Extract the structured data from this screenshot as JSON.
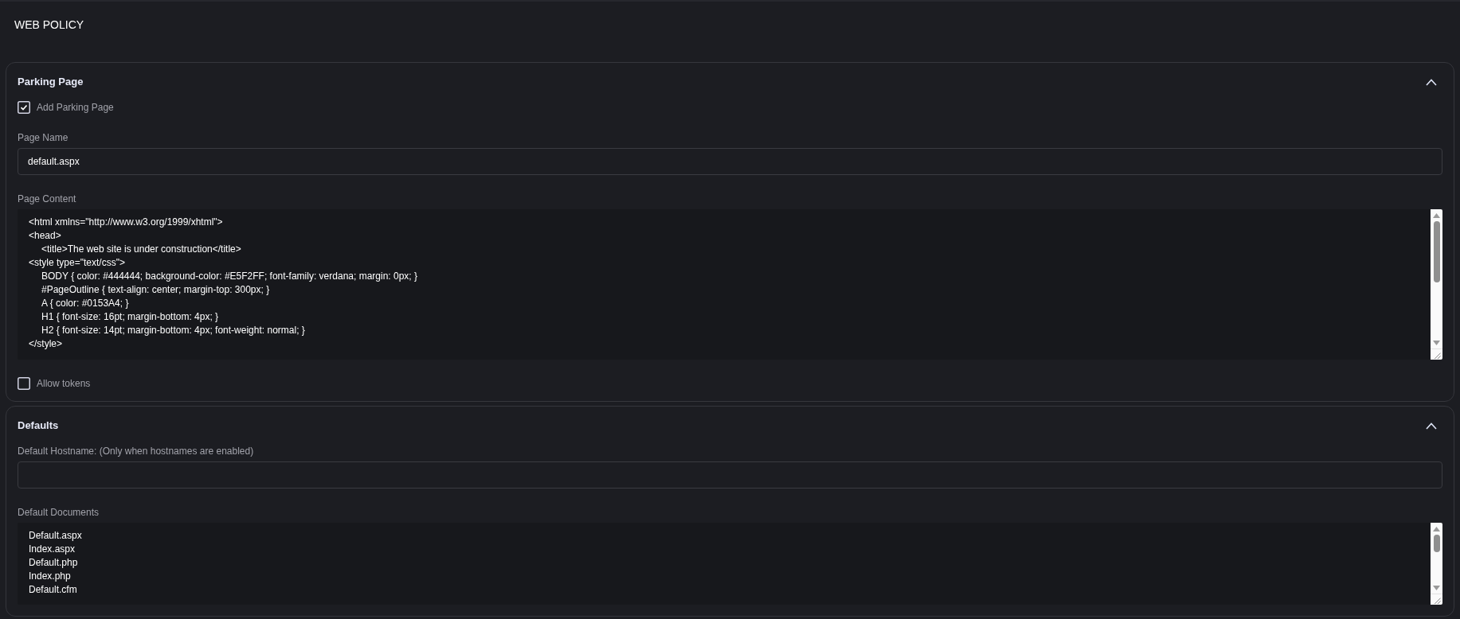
{
  "page_title": "WEB POLICY",
  "sections": [
    {
      "title": "Parking Page",
      "expanded": true,
      "fields": [
        {
          "kind": "checkbox",
          "label": "Add Parking Page",
          "checked": true
        },
        {
          "kind": "text",
          "label": "Page Name",
          "value": "default.aspx"
        },
        {
          "kind": "textarea",
          "label": "Page Content",
          "lines": [
            {
              "text": "<html xmlns=\"http://www.w3.org/1999/xhtml\">"
            },
            {
              "text": "<head>",
              "children": [
                {
                  "text": "<title>The web site is under construction</title>"
                }
              ]
            },
            {
              "text": "<style type=\"text/css\">",
              "children": [
                {
                  "text": "BODY { color: #444444; background-color: #E5F2FF; font-family: verdana; margin: 0px; }"
                },
                {
                  "text": "#PageOutline { text-align: center; margin-top: 300px; }"
                },
                {
                  "text": "A { color: #0153A4; }"
                },
                {
                  "text": "H1 { font-size: 16pt; margin-bottom: 4px; }"
                },
                {
                  "text": "H2 { font-size: 14pt; margin-bottom: 4px; font-weight: normal; }"
                }
              ]
            },
            {
              "text": "</style>"
            }
          ]
        },
        {
          "kind": "checkbox",
          "label": "Allow tokens",
          "checked": false
        }
      ]
    },
    {
      "title": "Defaults",
      "expanded": true,
      "fields": [
        {
          "kind": "text",
          "label": "Default Hostname: (Only when hostnames are enabled)"
        },
        {
          "kind": "textarea",
          "label": "Default Documents",
          "lines": [
            {
              "text": "Default.aspx"
            },
            {
              "text": "Index.aspx"
            },
            {
              "text": "Default.php"
            },
            {
              "text": "Index.php"
            },
            {
              "text": "Default.cfm"
            }
          ]
        }
      ]
    }
  ]
}
